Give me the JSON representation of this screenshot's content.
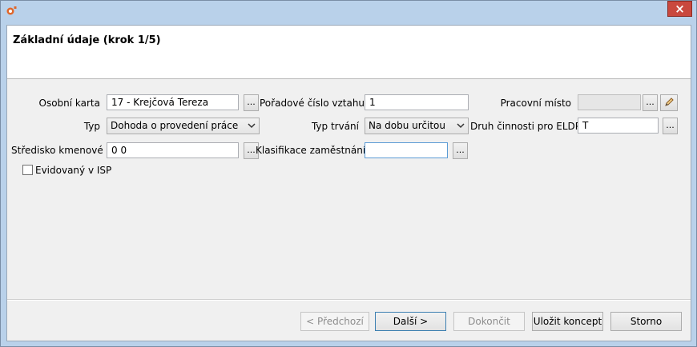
{
  "window": {
    "close_glyph": "×"
  },
  "header": {
    "title": "Základní údaje (krok 1/5)"
  },
  "form": {
    "osobni_karta": {
      "label": "Osobní karta",
      "value": "17 - Krejčová Tereza",
      "browse": "..."
    },
    "typ": {
      "label": "Typ",
      "value": "Dohoda o provedení práce"
    },
    "stredisko": {
      "label": "Středisko kmenové",
      "value": "0 0",
      "browse": "..."
    },
    "poradove": {
      "label": "Pořadové číslo vztahu",
      "value": "1"
    },
    "typ_trvani": {
      "label": "Typ trvání",
      "value": "Na dobu určitou"
    },
    "klasifikace": {
      "label": "Klasifikace zaměstnání",
      "value": "",
      "browse": "..."
    },
    "pracovni_misto": {
      "label": "Pracovní místo",
      "value": "",
      "browse": "...",
      "edit_icon": "pencil-icon"
    },
    "druh_cinnosti": {
      "label": "Druh činnosti pro ELDP",
      "value": "T",
      "browse": "..."
    },
    "evidovany": {
      "label": "Evidovaný v ISP",
      "checked": false
    }
  },
  "footer": {
    "prev": "< Předchozí",
    "next": "Další >",
    "finish": "Dokončit",
    "save_draft": "Uložit koncept",
    "cancel": "Storno"
  },
  "colors": {
    "window_frame": "#b9d1ea",
    "close_button": "#c9483e",
    "focus_border": "#5b9bd5"
  }
}
